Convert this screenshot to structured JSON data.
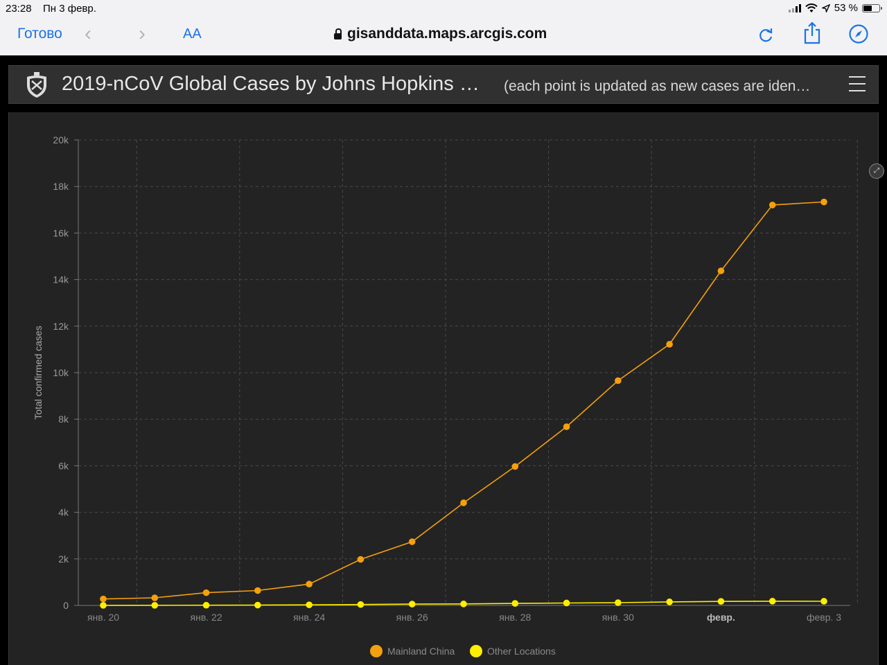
{
  "status": {
    "time": "23:28",
    "date": "Пн 3 февр.",
    "battery": "53 %"
  },
  "browser": {
    "done": "Готово",
    "text_size": "AA",
    "url": "gisanddata.maps.arcgis.com"
  },
  "header": {
    "title": "2019-nCoV Global Cases by Johns Hopkins …",
    "subtitle": "(each point is updated as new cases are iden…"
  },
  "colors": {
    "mainland": "#f5a00d",
    "other": "#ffee00",
    "background": "#232323",
    "link": "#1a73e8"
  },
  "chart_data": {
    "type": "line",
    "ylabel": "Total confirmed cases",
    "ylim": [
      0,
      20000
    ],
    "y_ticks": [
      0,
      2000,
      4000,
      6000,
      8000,
      10000,
      12000,
      14000,
      16000,
      18000,
      20000
    ],
    "y_tick_labels": [
      "0",
      "2k",
      "4k",
      "6k",
      "8k",
      "10k",
      "12k",
      "14k",
      "16k",
      "18k",
      "20k"
    ],
    "x_ticks": [
      {
        "label": "янв. 20",
        "bold": false
      },
      {
        "label": "янв. 22",
        "bold": false
      },
      {
        "label": "янв. 24",
        "bold": false
      },
      {
        "label": "янв. 26",
        "bold": false
      },
      {
        "label": "янв. 28",
        "bold": false
      },
      {
        "label": "янв. 30",
        "bold": false
      },
      {
        "label": "февр.",
        "bold": true
      },
      {
        "label": "февр. 3",
        "bold": false
      }
    ],
    "legend_position": "bottom",
    "series": [
      {
        "name": "Mainland China",
        "color": "#f5a00d",
        "values": [
          278,
          326,
          547,
          639,
          916,
          1979,
          2737,
          4409,
          5970,
          7678,
          9658,
          11221,
          14375,
          17205,
          17335
        ]
      },
      {
        "name": "Other Locations",
        "color": "#ffee00",
        "values": [
          4,
          6,
          8,
          14,
          25,
          40,
          57,
          64,
          87,
          105,
          118,
          153,
          173,
          183,
          179
        ]
      }
    ]
  }
}
